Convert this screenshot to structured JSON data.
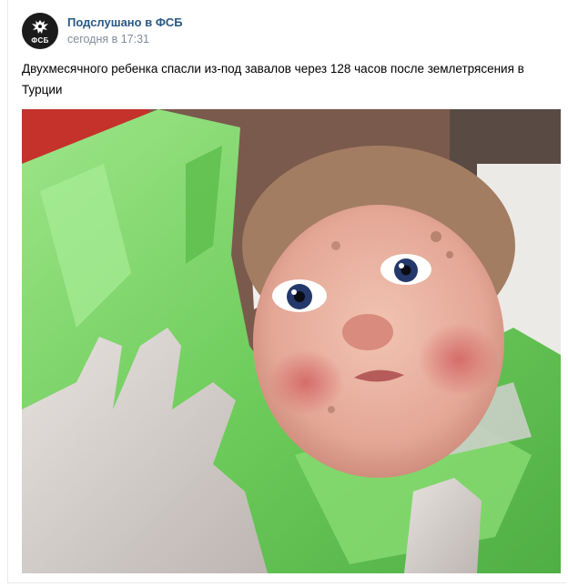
{
  "post": {
    "author": "Подслушано в ФСБ",
    "date": "сегодня в 17:31",
    "text": "Двухмесячного ребенка спасли из-под завалов через 128 часов после землетрясения в Турции",
    "avatar_label": "ФСБ",
    "avatar_icon": "double-headed-eagle-emblem",
    "photo_icon": "rescued-baby-photo"
  },
  "colors": {
    "author_link": "#2a5885",
    "date_text": "#818c99",
    "avatar_bg": "#1b1b1b",
    "blanket_green": "#7fd46a",
    "glove_gray": "#d7d2cf"
  }
}
